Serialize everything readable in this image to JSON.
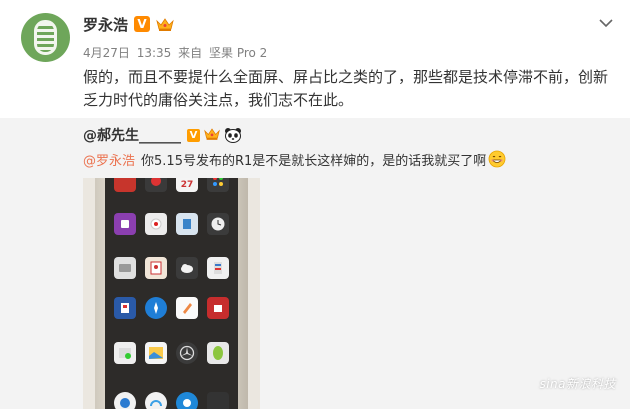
{
  "post": {
    "author": "罗永浩",
    "verified_mark": "V",
    "meta": {
      "date": "4月27日",
      "time": "13:35",
      "source_prefix": "来自",
      "source": "坚果 Pro 2"
    },
    "text": "假的，而且不要提什么全面屏、屏占比之类的了，那些都是技术停滞不前，创新乏力时代的庸俗关注点，我们志不在此。",
    "avatar_icon": "cocoon-avatar-icon",
    "menu_icon": "chevron-down-icon"
  },
  "repost": {
    "user": "@郝先生______",
    "verified_mark": "V",
    "mention": "@罗永浩",
    "text": "你5.15号发布的R1是不是就长这样婶的，是的话我就买了啊",
    "trailing_emoji": "grinning-face-icon"
  },
  "photo": {
    "description_icon": "phone-homescreen-image",
    "calendar_day": "27"
  },
  "watermark": {
    "logo": "sina",
    "text": "新浪科技"
  },
  "colors": {
    "mention": "#eb7350",
    "verified": "#ff8a00",
    "repost_bg": "#f3f3f3",
    "meta_gray": "#808080"
  }
}
